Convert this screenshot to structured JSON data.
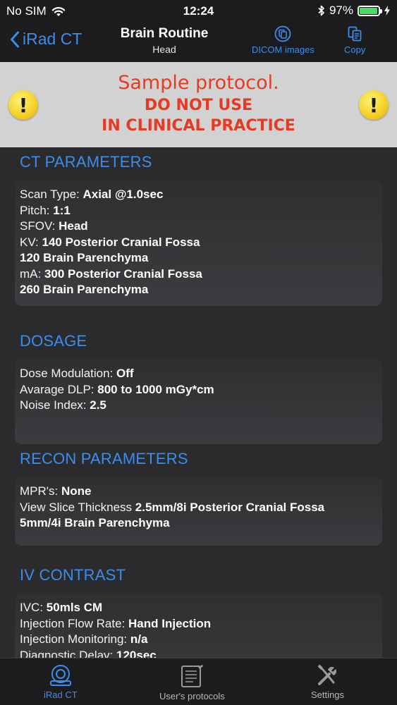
{
  "status_bar": {
    "carrier": "No SIM",
    "time": "12:24",
    "battery_percent": "97%",
    "battery_level": 0.97,
    "battery_color": "#4cd964"
  },
  "nav": {
    "back_label": "iRad CT",
    "title": "Brain Routine",
    "subtitle": "Head",
    "dicom_label": "DICOM images",
    "copy_label": "Copy"
  },
  "banner": {
    "line1": "Sample protocol.",
    "line2": "DO NOT USE",
    "line3": "IN CLINICAL PRACTICE",
    "warning_glyph": "!"
  },
  "sections": {
    "ct": {
      "title": "CT PARAMETERS",
      "scan_type_label": "Scan Type: ",
      "scan_type_value": "Axial @1.0sec",
      "pitch_label": "Pitch: ",
      "pitch_value": "1:1",
      "sfov_label": "SFOV: ",
      "sfov_value": "Head",
      "kv_label": "KV: ",
      "kv_value": "140 Posterior Cranial Fossa",
      "kv_value2": "120 Brain Parenchyma",
      "ma_label": "mA: ",
      "ma_value": "300 Posterior Cranial Fossa",
      "ma_value2": "260 Brain Parenchyma"
    },
    "dosage": {
      "title": "DOSAGE",
      "dose_mod_label": "Dose Modulation: ",
      "dose_mod_value": "Off",
      "dlp_label": "Avarage DLP: ",
      "dlp_value": "800 to 1000 mGy*cm",
      "noise_label": "Noise Index: ",
      "noise_value": "2.5"
    },
    "recon": {
      "title": "RECON PARAMETERS",
      "mpr_label": "MPR's: ",
      "mpr_value": "None",
      "slice_label": "View Slice Thickness ",
      "slice_value": "2.5mm/8i Posterior Cranial Fossa",
      "slice_value2": "5mm/4i Brain Parenchyma"
    },
    "contrast": {
      "title": "IV CONTRAST",
      "ivc_label": "IVC: ",
      "ivc_value": "50mls CM",
      "flow_label": "Injection Flow Rate: ",
      "flow_value": "Hand Injection",
      "monitor_label": "Injection Monitoring: ",
      "monitor_value": "n/a",
      "delay_label": "Diagnostic Delay: ",
      "delay_value": "120sec"
    }
  },
  "tabs": {
    "irad": "iRad CT",
    "user": "User's protocols",
    "settings": "Settings"
  },
  "colors": {
    "accent": "#3b8ded",
    "warning_text": "#e83a22",
    "banner_bg": "#d2d2d2",
    "background": "#2b2b2d"
  }
}
